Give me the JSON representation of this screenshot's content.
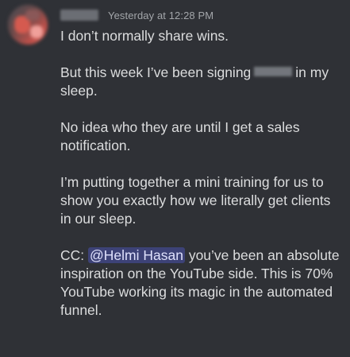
{
  "message": {
    "timestamp": "Yesterday at 12:28 PM",
    "paragraphs": {
      "p1": "I don’t normally share wins.",
      "p2_before": "But this week I’ve been signing",
      "p2_after": "in my sleep.",
      "p3": "No idea who they are until I get a sales notification.",
      "p4": "I’m putting together a mini training for us to show you exactly how we literally get clients in our sleep.",
      "p5_before": "CC:",
      "mention": "@Helmi Hasan",
      "p5_after": "you’ve been an absolute inspiration on the YouTube side. This is 70% YouTube working its magic in the automated funnel."
    }
  },
  "colors": {
    "background": "#2f3136",
    "text": "#dcddde",
    "timestamp": "#a3a6aa",
    "mention_bg": "rgba(88,101,242,0.35)"
  }
}
